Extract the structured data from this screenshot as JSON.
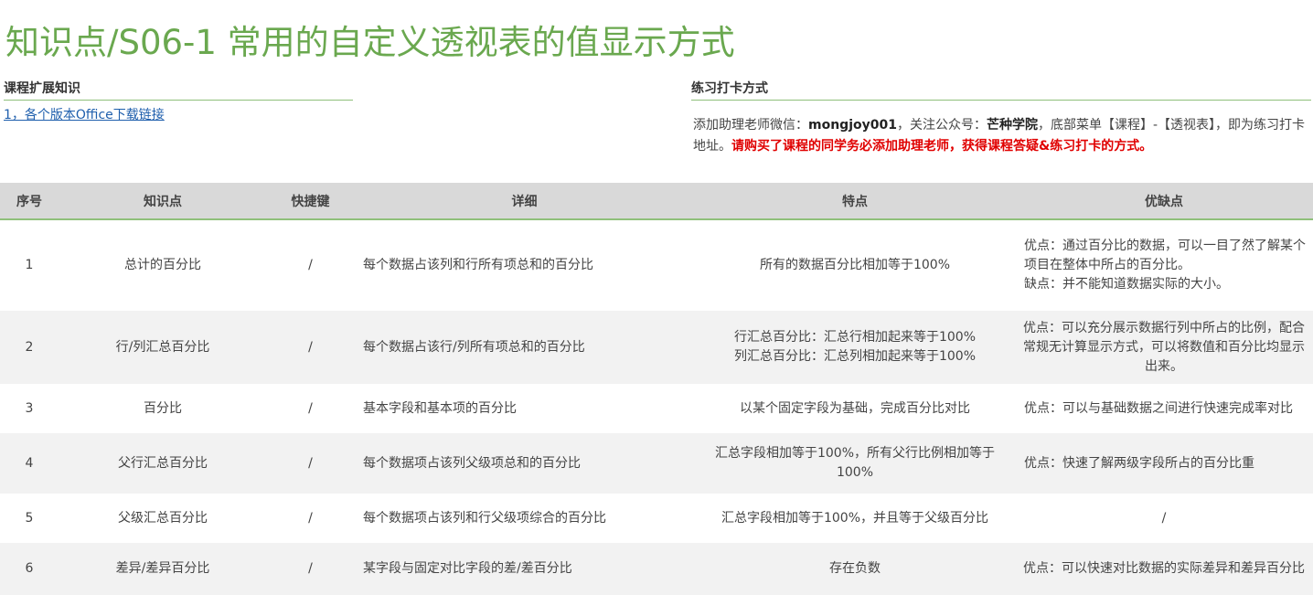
{
  "page_title": "知识点/S06-1 常用的自定义透视表的值显示方式",
  "left_section": {
    "heading": "课程扩展知识",
    "link": "1，各个版本Office下载链接"
  },
  "right_section": {
    "heading": "练习打卡方式",
    "p1": "添加助理老师微信：",
    "wechat": "mongjoy001",
    "p2": "，关注公众号：",
    "account": "芒种学院",
    "p3": "，底部菜单【课程】-【透视表】，即为练习打卡地址。",
    "red": "请购买了课程的同学务必添加助理老师，获得课程答疑&练习打卡的方式。"
  },
  "table": {
    "headers": [
      "序号",
      "知识点",
      "快捷键",
      "详细",
      "特点",
      "优缺点"
    ],
    "rows": [
      {
        "no": "1",
        "point": "总计的百分比",
        "shortcut": "/",
        "detail": "每个数据占该列和行所有项总和的百分比",
        "feature": [
          "所有的数据百分比相加等于100%"
        ],
        "pros": [
          "优点：通过百分比的数据，可以一目了然了解某个项目在整体中所占的百分比。",
          "缺点：并不能知道数据实际的大小。"
        ]
      },
      {
        "no": "2",
        "point": "行/列汇总百分比",
        "shortcut": "/",
        "detail": "每个数据占该行/列所有项总和的百分比",
        "feature": [
          "行汇总百分比：汇总行相加起来等于100%",
          "列汇总百分比：汇总列相加起来等于100%"
        ],
        "pros": [
          "优点：可以充分展示数据行列中所占的比例，配合常规无计算显示方式，可以将数值和百分比均显示出来。"
        ]
      },
      {
        "no": "3",
        "point": "百分比",
        "shortcut": "/",
        "detail": "基本字段和基本项的百分比",
        "feature": [
          "以某个固定字段为基础，完成百分比对比"
        ],
        "pros": [
          "优点：可以与基础数据之间进行快速完成率对比"
        ]
      },
      {
        "no": "4",
        "point": "父行汇总百分比",
        "shortcut": "/",
        "detail": "每个数据项占该列父级项总和的百分比",
        "feature": [
          "汇总字段相加等于100%，所有父行比例相加等于100%"
        ],
        "pros": [
          "优点：快速了解两级字段所占的百分比重"
        ]
      },
      {
        "no": "5",
        "point": "父级汇总百分比",
        "shortcut": "/",
        "detail": "每个数据项占该列和行父级项综合的百分比",
        "feature": [
          "汇总字段相加等于100%，并且等于父级百分比"
        ],
        "pros": [
          "/"
        ]
      },
      {
        "no": "6",
        "point": "差异/差异百分比",
        "shortcut": "/",
        "detail": "某字段与固定对比字段的差/差百分比",
        "feature": [
          "存在负数"
        ],
        "pros": [
          "优点：可以快速对比数据的实际差异和差异百分比"
        ]
      }
    ]
  }
}
